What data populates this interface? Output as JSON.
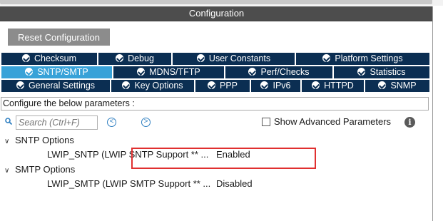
{
  "window": {
    "title": "Configuration"
  },
  "toolbar": {
    "reset_label": "Reset Configuration"
  },
  "tabs": {
    "row1": [
      {
        "label": "Checksum"
      },
      {
        "label": "Debug"
      },
      {
        "label": "User Constants"
      },
      {
        "label": "Platform Settings"
      }
    ],
    "row2": [
      {
        "label": "SNTP/SMTP",
        "active": true
      },
      {
        "label": "MDNS/TFTP"
      },
      {
        "label": "Perf/Checks"
      },
      {
        "label": "Statistics"
      }
    ],
    "row3": [
      {
        "label": "General Settings"
      },
      {
        "label": "Key Options"
      },
      {
        "label": "PPP"
      },
      {
        "label": "IPv6"
      },
      {
        "label": "HTTPD"
      },
      {
        "label": "SNMP"
      }
    ]
  },
  "panel": {
    "subtitle": "Configure the below parameters :"
  },
  "search": {
    "placeholder": "Search (Ctrl+F)"
  },
  "nav": {
    "prev_icon": "<",
    "next_icon": ">"
  },
  "advanced": {
    "label": "Show Advanced Parameters",
    "checked": false
  },
  "info": {
    "glyph": "i"
  },
  "groups": [
    {
      "label": "SNTP Options",
      "chevron": "∨",
      "params": [
        {
          "name": "LWIP_SNTP (LWIP SNTP Support ** ...",
          "value": "Enabled"
        }
      ]
    },
    {
      "label": "SMTP Options",
      "chevron": "∨",
      "params": [
        {
          "name": "LWIP_SMTP (LWIP SMTP Support ** ...",
          "value": "Disabled"
        }
      ]
    }
  ],
  "colors": {
    "tab_bg": "#0b2e52",
    "tab_active": "#38a2d8",
    "highlight": "#e03030",
    "titlebar": "#4d4d4d"
  }
}
